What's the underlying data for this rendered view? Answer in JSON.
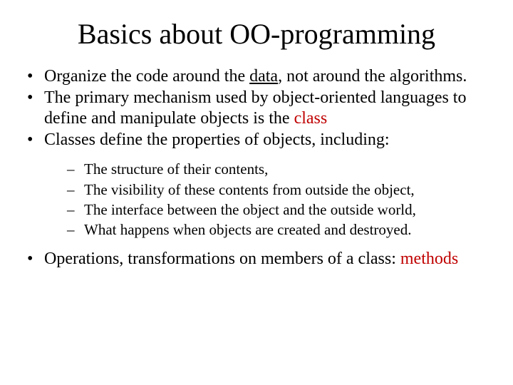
{
  "title": "Basics about OO-programming",
  "b1_a": "Organize the code around the ",
  "b1_u": "data",
  "b1_b": ", not around the algorithms.",
  "b2_a": "The primary mechanism used by object-oriented languages to define and manipulate objects is the ",
  "b2_r": "class",
  "b3": "Classes define the properties of objects, including:",
  "s1": "The structure of their contents,",
  "s2": "The visibility of these contents from outside the object,",
  "s3": "The interface between the object and the outside world,",
  "s4": "What happens when objects are created and destroyed.",
  "b4_a": "Operations, transformations on members of a class: ",
  "b4_r": "methods"
}
